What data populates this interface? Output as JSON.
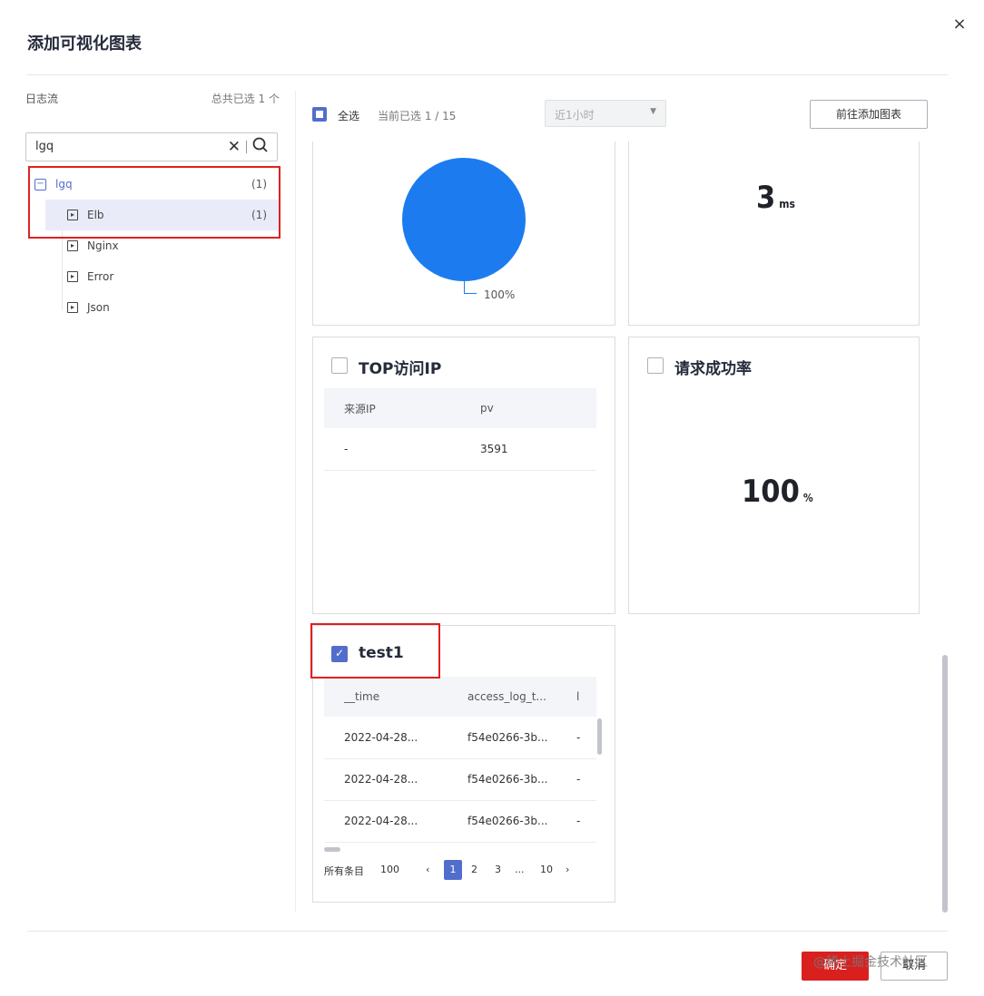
{
  "dialog": {
    "title": "添加可视化图表",
    "close_label": "×"
  },
  "left_panel": {
    "header": "日志流",
    "selected_count": "总共已选 1 个",
    "search": {
      "value": "lgq"
    },
    "tree": {
      "root": {
        "label": "lgq",
        "count": "(1)",
        "toggle": "−"
      },
      "children": [
        {
          "label": "Elb",
          "count": "(1)"
        },
        {
          "label": "Nginx",
          "count": ""
        },
        {
          "label": "Error",
          "count": ""
        },
        {
          "label": "Json",
          "count": ""
        }
      ]
    }
  },
  "toolbar": {
    "select_all": "全选",
    "selected": "当前已选 1 / 15",
    "time_range": "近1小时",
    "goto_button": "前往添加图表"
  },
  "cards": {
    "pie": {
      "label": "100%"
    },
    "metric": {
      "value": "3",
      "unit": "ms"
    },
    "top_ip": {
      "title": "TOP访问IP",
      "columns": [
        "来源IP",
        "pv"
      ],
      "rows": [
        [
          "-",
          "3591"
        ]
      ]
    },
    "success_rate": {
      "title": "请求成功率",
      "value": "100",
      "unit": "%"
    },
    "test1": {
      "title": "test1",
      "columns": [
        "__time",
        "access_log_t...",
        "l"
      ],
      "rows": [
        [
          "2022-04-28...",
          "f54e0266-3b...",
          "-"
        ],
        [
          "2022-04-28...",
          "f54e0266-3b...",
          "-"
        ],
        [
          "2022-04-28...",
          "f54e0266-3b...",
          "-"
        ]
      ],
      "pager": {
        "total_label": "所有条目",
        "total": "100",
        "prev": "‹",
        "pages": [
          "1",
          "2",
          "3",
          "...",
          "10"
        ],
        "next": "›"
      }
    }
  },
  "footer": {
    "confirm": "确定",
    "cancel": "取消"
  },
  "watermark": "@稀土掘金技术社区",
  "colors": {
    "accent": "#526ecc",
    "pie": "#1c7cef",
    "confirm": "#d9201e",
    "highlight": "#e02020"
  }
}
